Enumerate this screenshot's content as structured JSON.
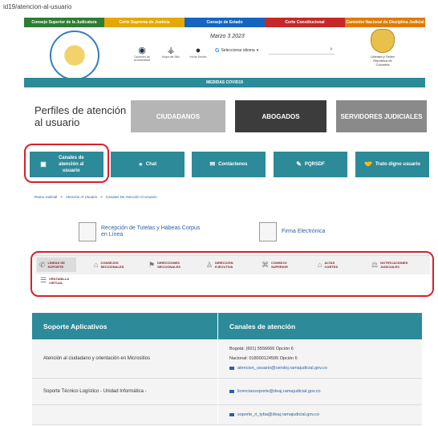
{
  "browser": {
    "url": "id19/atencion-al-usuario"
  },
  "topnav": [
    {
      "label": "Consejo Superior de la Judicatura",
      "color": "#2e7d32"
    },
    {
      "label": "Corte Suprema de Justicia",
      "color": "#e6a700"
    },
    {
      "label": "Consejo de Estado",
      "color": "#1565c0"
    },
    {
      "label": "Corte Constitucional",
      "color": "#c62828"
    },
    {
      "label": "Comisión Nacional de Disciplina Judicial",
      "color": "#e07b00"
    }
  ],
  "header": {
    "date": "Marzo 3 2023",
    "tools": [
      {
        "icon": "eye-icon",
        "label": "Opciones de Accesibilidad",
        "glyph": "◉"
      },
      {
        "icon": "sitemap-icon",
        "label": "Mapa del Sitio",
        "glyph": "⚶"
      },
      {
        "icon": "user-icon",
        "label": "Iniciar Sesión",
        "glyph": "●"
      }
    ],
    "language_select": "Seleccionar idioma",
    "search_icon": "⌕",
    "right_logo_caption": "Libertad y Orden República de Colombia"
  },
  "covid_bar": "MEDIDAS COVID19",
  "page_title": "Perfiles de atención al usuario",
  "banners": [
    {
      "label": "CIUDADANOS",
      "bg": "#b5b5b5"
    },
    {
      "label": "ABOGADOS",
      "bg": "#3c3c3c"
    },
    {
      "label": "SERVIDORES JUDICIALES",
      "bg": "#8a8a8a"
    }
  ],
  "buttons": [
    {
      "label": "Canales de atención al usuario",
      "icon": "▣"
    },
    {
      "label": "Chat",
      "icon": "●"
    },
    {
      "label": "Contáctenos",
      "icon": "✉"
    },
    {
      "label": "PQRSDF",
      "icon": "✎"
    },
    {
      "label": "Trato digno usuario",
      "icon": "🤝"
    }
  ],
  "breadcrumb": {
    "items": [
      "Rama Judicial",
      "Atención Al Usuario",
      "Canales De Atención Al Usuario"
    ],
    "sep": ">"
  },
  "quick_links": [
    {
      "label": "Recepción de Tutelas y Hábeas Corpus en Línea"
    },
    {
      "label": "Firma Electrónica"
    }
  ],
  "tabs": [
    {
      "label": "LÍNEAS DE SOPORTE",
      "icon": "✆"
    },
    {
      "label": "CONSEJOS SECCIONALES",
      "icon": "⌂"
    },
    {
      "label": "DIRECCIONES SECCIONALES",
      "icon": "⚑"
    },
    {
      "label": "DIRECCIÓN EJECUTIVA",
      "icon": "♙"
    },
    {
      "label": "CONSEJO SUPERIOR",
      "icon": "⌘"
    },
    {
      "label": "ALTAS CORTES",
      "icon": "⌂"
    },
    {
      "label": "NOTIFICACIONES JUDICIALES",
      "icon": "⚖"
    },
    {
      "label": "VENTANILLA VIRTUAL",
      "icon": "☰"
    }
  ],
  "table": {
    "headers": [
      "Soporte Aplicativos",
      "Canales de atención"
    ],
    "rows": [
      {
        "service": "Atención al ciudadano y orientación en Micrositios",
        "lines": [
          "Bogotá: (601) 5556666 Opción 6",
          "Nacional: 018000124595 Opción 6"
        ],
        "email": "atencion_usuario@cendoj.ramajudicial.gov.co"
      },
      {
        "service": "Soporte Técnico Logístico - Unidad Informática -",
        "lines": [],
        "email": "licenciassoporte@deaj.ramajudicial.gov.co"
      },
      {
        "service": "",
        "lines": [],
        "email": "soporte_ri_tyba@deaj.ramajudicial.gov.co"
      }
    ]
  }
}
